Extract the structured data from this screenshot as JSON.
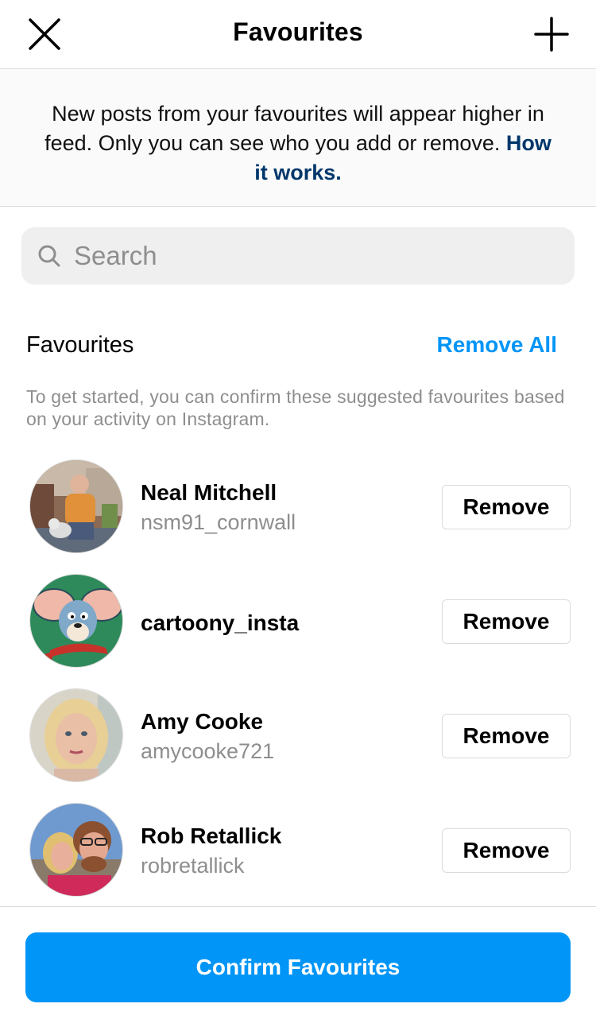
{
  "header": {
    "title": "Favourites",
    "close_icon": "close-icon",
    "add_icon": "plus-icon"
  },
  "banner": {
    "text": "New posts from your favourites will appear higher in feed. Only you can see who you add or remove.",
    "link": "How it works."
  },
  "search": {
    "placeholder": "Search",
    "value": ""
  },
  "section": {
    "title": "Favourites",
    "remove_all": "Remove All",
    "hint": "To get started, you can confirm these suggested favourites based on your activity on Instagram."
  },
  "users": [
    {
      "name": "Neal Mitchell",
      "handle": "nsm91_cornwall",
      "button": "Remove"
    },
    {
      "name": "cartoony_insta",
      "handle": "",
      "button": "Remove"
    },
    {
      "name": "Amy Cooke",
      "handle": "amycooke721",
      "button": "Remove"
    },
    {
      "name": "Rob Retallick",
      "handle": "robretallick",
      "button": "Remove"
    }
  ],
  "footer": {
    "confirm": "Confirm Favourites"
  },
  "colors": {
    "accent": "#0095f6",
    "link": "#00376b",
    "muted": "#8e8e8e",
    "banner_bg": "#fafafa",
    "border": "#dbdbdb"
  }
}
